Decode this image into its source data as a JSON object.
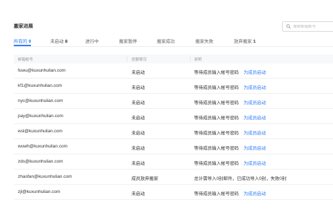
{
  "page": {
    "title": "搬家进展",
    "search_placeholder": "搜索邮箱帐号"
  },
  "tabs": [
    {
      "label": "所有的",
      "count": "9"
    },
    {
      "label": "未启动",
      "count": "8"
    },
    {
      "label": "进行中",
      "count": ""
    },
    {
      "label": "搬家暂停",
      "count": ""
    },
    {
      "label": "搬家成功",
      "count": ""
    },
    {
      "label": "搬家失败",
      "count": ""
    },
    {
      "label": "放弃搬家",
      "count": "1"
    }
  ],
  "table": {
    "headers": [
      "邮箱帐号",
      "进展情况",
      "说明"
    ],
    "rows": [
      {
        "email": "fuwu@kuxunhulian.com",
        "status": "未启动",
        "desc": "等待成员输入帐号密码",
        "action": "为成员启动"
      },
      {
        "email": "kf1@kuxunhulian.com",
        "status": "未启动",
        "desc": "等待成员输入帐号密码",
        "action": "为成员启动"
      },
      {
        "email": "nyc@kuxunhulian.com",
        "status": "未启动",
        "desc": "等待成员输入帐号密码",
        "action": "为成员启动"
      },
      {
        "email": "pay@kuxunhulian.com",
        "status": "未启动",
        "desc": "等待成员输入帐号密码",
        "action": "为成员启动"
      },
      {
        "email": "wsl@kuxunhulian.com",
        "status": "未启动",
        "desc": "等待成员输入帐号密码",
        "action": "为成员启动"
      },
      {
        "email": "wuwh@kuxunhulian.com",
        "status": "未启动",
        "desc": "等待成员输入帐号密码",
        "action": "为成员启动"
      },
      {
        "email": "zds@kuxunhulian.com",
        "status": "未启动",
        "desc": "等待成员输入帐号密码",
        "action": "为成员启动"
      },
      {
        "email": "zhaofan@kuxunhulian.com",
        "status": "成员放弃搬家",
        "desc": "总计需导入0封邮件，已成功导入0封，失败0封",
        "action": ""
      },
      {
        "email": "zjl@kuxunhulian.com",
        "status": "未启动",
        "desc": "等待成员输入帐号密码",
        "action": "为成员启动"
      }
    ]
  },
  "colors": {
    "accent": "#2f7df6",
    "header_bg": "#f7f8fa"
  }
}
